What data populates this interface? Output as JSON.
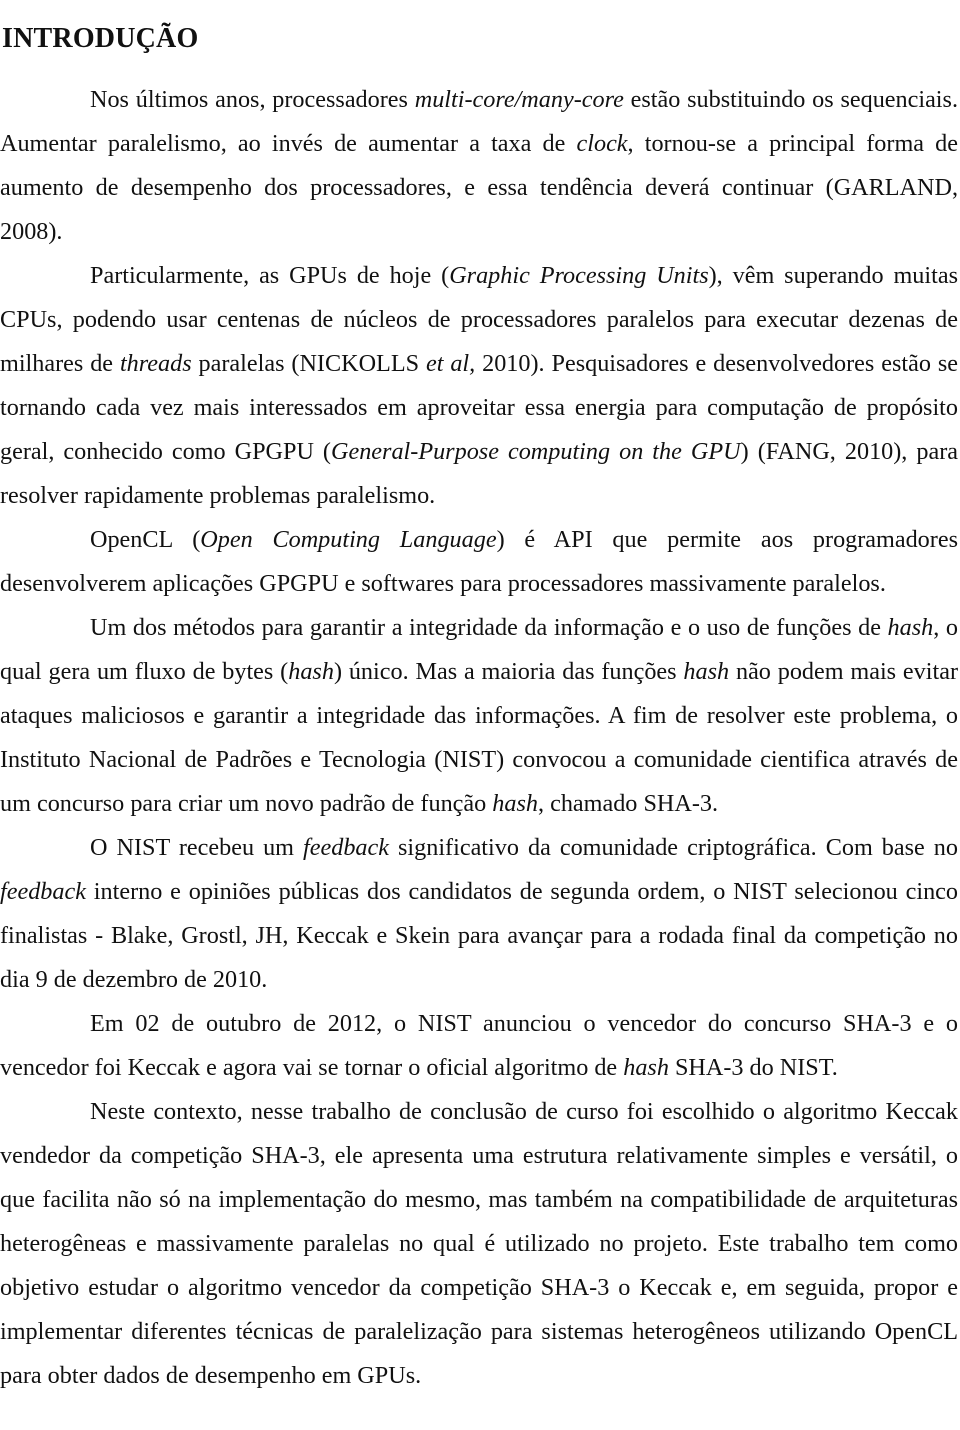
{
  "document": {
    "heading": "INTRODUÇÃO",
    "language": "pt-BR",
    "text_color": "#111111",
    "background_color": "#ffffff",
    "paragraphs": [
      {
        "id": "p1",
        "indent": true,
        "runs": [
          {
            "style": "normal",
            "text": "Nos últimos anos, processadores "
          },
          {
            "style": "italic",
            "text": "multi-core/many-core"
          },
          {
            "style": "normal",
            "text": " estão substituindo os sequenciais. Aumentar paralelismo, ao invés de aumentar a taxa de "
          },
          {
            "style": "italic",
            "text": "clock"
          },
          {
            "style": "normal",
            "text": ", tornou-se a principal forma de aumento de desempenho dos processadores, e essa tendência deverá continuar (GARLAND, 2008)."
          }
        ]
      },
      {
        "id": "p2",
        "indent": true,
        "runs": [
          {
            "style": "normal",
            "text": "Particularmente, as GPUs de hoje ("
          },
          {
            "style": "italic",
            "text": "Graphic Processing Units"
          },
          {
            "style": "normal",
            "text": "), vêm superando muitas CPUs, podendo usar centenas de núcleos de processadores paralelos para executar dezenas de milhares de "
          },
          {
            "style": "italic",
            "text": "threads"
          },
          {
            "style": "normal",
            "text": " paralelas (NICKOLLS "
          },
          {
            "style": "italic",
            "text": "et al,"
          },
          {
            "style": "normal",
            "text": " 2010). Pesquisadores e desenvolvedores estão se tornando cada vez mais interessados em aproveitar essa energia para computação de propósito geral, conhecido como GPGPU ("
          },
          {
            "style": "italic",
            "text": "General-Purpose computing on the GPU"
          },
          {
            "style": "normal",
            "text": ") (FANG, 2010), para resolver rapidamente  problemas paralelismo."
          }
        ]
      },
      {
        "id": "p3",
        "indent": true,
        "runs": [
          {
            "style": "normal",
            "text": "OpenCL ("
          },
          {
            "style": "italic",
            "text": "Open Computing Language"
          },
          {
            "style": "normal",
            "text": ") é API que permite aos programadores desenvolverem aplicações GPGPU e softwares para processadores massivamente paralelos."
          }
        ]
      },
      {
        "id": "p4",
        "indent": true,
        "runs": [
          {
            "style": "normal",
            "text": "Um dos métodos para garantir a integridade da informação e o uso de funções de "
          },
          {
            "style": "italic",
            "text": "hash"
          },
          {
            "style": "normal",
            "text": ", o qual gera um fluxo de bytes ("
          },
          {
            "style": "italic",
            "text": "hash"
          },
          {
            "style": "normal",
            "text": ") único. Mas a maioria das funções "
          },
          {
            "style": "italic",
            "text": "hash"
          },
          {
            "style": "normal",
            "text": " não podem mais evitar ataques maliciosos e garantir a integridade das informações. A fim de resolver este problema, o Instituto Nacional de Padrões e Tecnologia (NIST) convocou a comunidade cientifica através de um concurso para criar um novo padrão de função "
          },
          {
            "style": "italic",
            "text": "hash"
          },
          {
            "style": "normal",
            "text": ", chamado SHA-3."
          }
        ]
      },
      {
        "id": "p5",
        "indent": true,
        "runs": [
          {
            "style": "normal",
            "text": "O NIST recebeu um "
          },
          {
            "style": "italic",
            "text": "feedback"
          },
          {
            "style": "normal",
            "text": " significativo da comunidade criptográfica. Com base no "
          },
          {
            "style": "italic",
            "text": "feedback"
          },
          {
            "style": "normal",
            "text": " interno e opiniões públicas dos candidatos de segunda ordem, o NIST selecionou cinco finalistas - Blake, Grostl, JH, Keccak e Skein para avançar para a rodada final da competição no dia 9 de dezembro de 2010."
          }
        ]
      },
      {
        "id": "p6",
        "indent": true,
        "runs": [
          {
            "style": "normal",
            "text": "Em 02 de outubro de 2012, o NIST anunciou o vencedor do concurso SHA-3 e o vencedor foi Keccak e agora vai se tornar o oficial algoritmo de "
          },
          {
            "style": "italic",
            "text": "hash"
          },
          {
            "style": "normal",
            "text": " SHA-3 do NIST."
          }
        ]
      },
      {
        "id": "p7",
        "indent": true,
        "runs": [
          {
            "style": "normal",
            "text": "Neste contexto, nesse trabalho de conclusão de curso foi escolhido o algoritmo Keccak vendedor da competição SHA-3, ele apresenta uma estrutura relativamente simples e versátil, o que facilita não só na implementação do mesmo, mas também na compatibilidade de arquiteturas heterogêneas e massivamente paralelas no qual é utilizado no projeto. Este trabalho tem como objetivo estudar o algoritmo vencedor da competição SHA-3 o Keccak e, em seguida, propor e implementar diferentes técnicas de paralelização para sistemas heterogêneos utilizando OpenCL para obter dados de desempenho em GPUs."
          }
        ]
      }
    ]
  }
}
